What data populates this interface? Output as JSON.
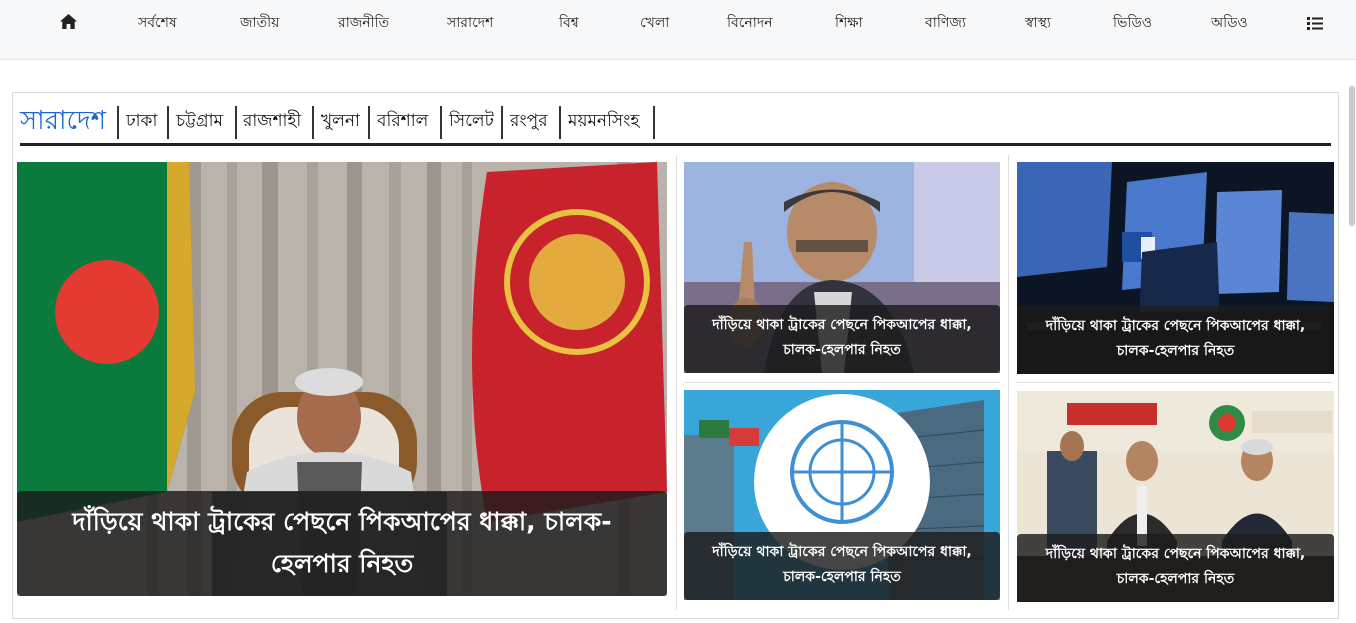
{
  "nav": {
    "home_icon": "home-icon",
    "items": [
      "সর্বশেষ",
      "জাতীয়",
      "রাজনীতি",
      "সারাদেশ",
      "বিশ্ব",
      "খেলা",
      "বিনোদন",
      "শিক্ষা",
      "বাণিজ্য",
      "স্বাস্থ্য",
      "ভিডিও",
      "অডিও"
    ],
    "menu_icon": "list-menu-icon"
  },
  "section": {
    "title": "সারাদেশ",
    "subcategories": [
      "ঢাকা",
      "চট্টগ্রাম",
      "রাজশাহী",
      "খুলনা",
      "বরিশাল",
      "সিলেট",
      "রংপুর",
      "ময়মনসিংহ"
    ]
  },
  "lead": {
    "headline": "দাঁড়িয়ে থাকা ট্রাকের পেছনে পিকআপের ধাক্কা, চালক-হেলপার নিহত"
  },
  "stories": [
    {
      "line1": "দাঁড়িয়ে থাকা ট্রাকের পেছনে পিকআপের ধাক্কা,",
      "line2": "চালক-হেলপার নিহত",
      "image": "man-pointing-photo"
    },
    {
      "line1": "দাঁড়িয়ে থাকা ট্রাকের পেছনে পিকআপের ধাক্কা,",
      "line2": "চালক-হেলপার নিহত",
      "image": "facebook-screens-photo"
    },
    {
      "line1": "দাঁড়িয়ে থাকা ট্রাকের পেছনে পিকআপের ধাক্কা,",
      "line2": "চালক-হেলপার নিহত",
      "image": "united-nations-photo"
    },
    {
      "line1": "দাঁড়িয়ে থাকা ট্রাকের পেছনে পিকআপের ধাক্কা,",
      "line2": "চালক-হেলপার নিহত",
      "image": "meeting-photo"
    }
  ],
  "colors": {
    "section_title": "#1a66d6",
    "caption_bg": "#1c1c1c"
  }
}
